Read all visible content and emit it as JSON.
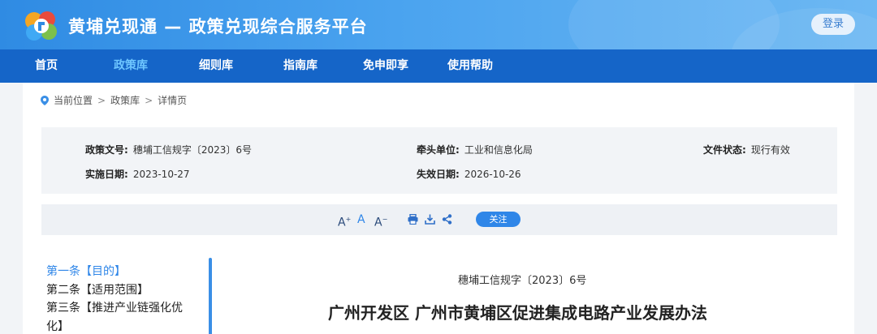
{
  "header": {
    "title": "黄埔兑现通 — 政策兑现综合服务平台",
    "login_label": "登录"
  },
  "nav": {
    "items": [
      {
        "label": "首页"
      },
      {
        "label": "政策库"
      },
      {
        "label": "细则库"
      },
      {
        "label": "指南库"
      },
      {
        "label": "免申即享"
      },
      {
        "label": "使用帮助"
      }
    ],
    "active": "政策库"
  },
  "breadcrumb": {
    "current_position": "当前位置",
    "items": [
      "政策库",
      "详情页"
    ],
    "separator": ">"
  },
  "policy_info": {
    "doc_number": {
      "key": "政策文号:",
      "value": "穗埔工信规字〔2023〕6号"
    },
    "lead_unit": {
      "key": "牵头单位:",
      "value": "工业和信息化局"
    },
    "status": {
      "key": "文件状态:",
      "value": "现行有效"
    },
    "start_date": {
      "key": "实施日期:",
      "value": "2023-10-27"
    },
    "end_date": {
      "key": "失效日期:",
      "value": "2026-10-26"
    }
  },
  "toolbar": {
    "font_increase": "A",
    "font_normal": "A",
    "font_decrease": "A",
    "follow_label": "关注",
    "icons": [
      "font-increase-icon",
      "font-normal-icon",
      "font-decrease-icon",
      "print-icon",
      "download-icon",
      "share-icon"
    ]
  },
  "toc": {
    "items": [
      {
        "label": "第一条【目的】"
      },
      {
        "label": "第二条【适用范围】"
      },
      {
        "label": "第三条【推进产业链强化优化】"
      }
    ],
    "active_index": 0
  },
  "document": {
    "doc_number": "穗埔工信规字〔2023〕6号",
    "title": "广州开发区 广州市黄埔区促进集成电路产业发展办法"
  },
  "colors": {
    "header_gradient_start": "#2f8be3",
    "nav_bg": "#1565c8",
    "nav_active": "#6ec6ff",
    "accent": "#2f86e8",
    "info_bg": "#f2f4f7"
  }
}
